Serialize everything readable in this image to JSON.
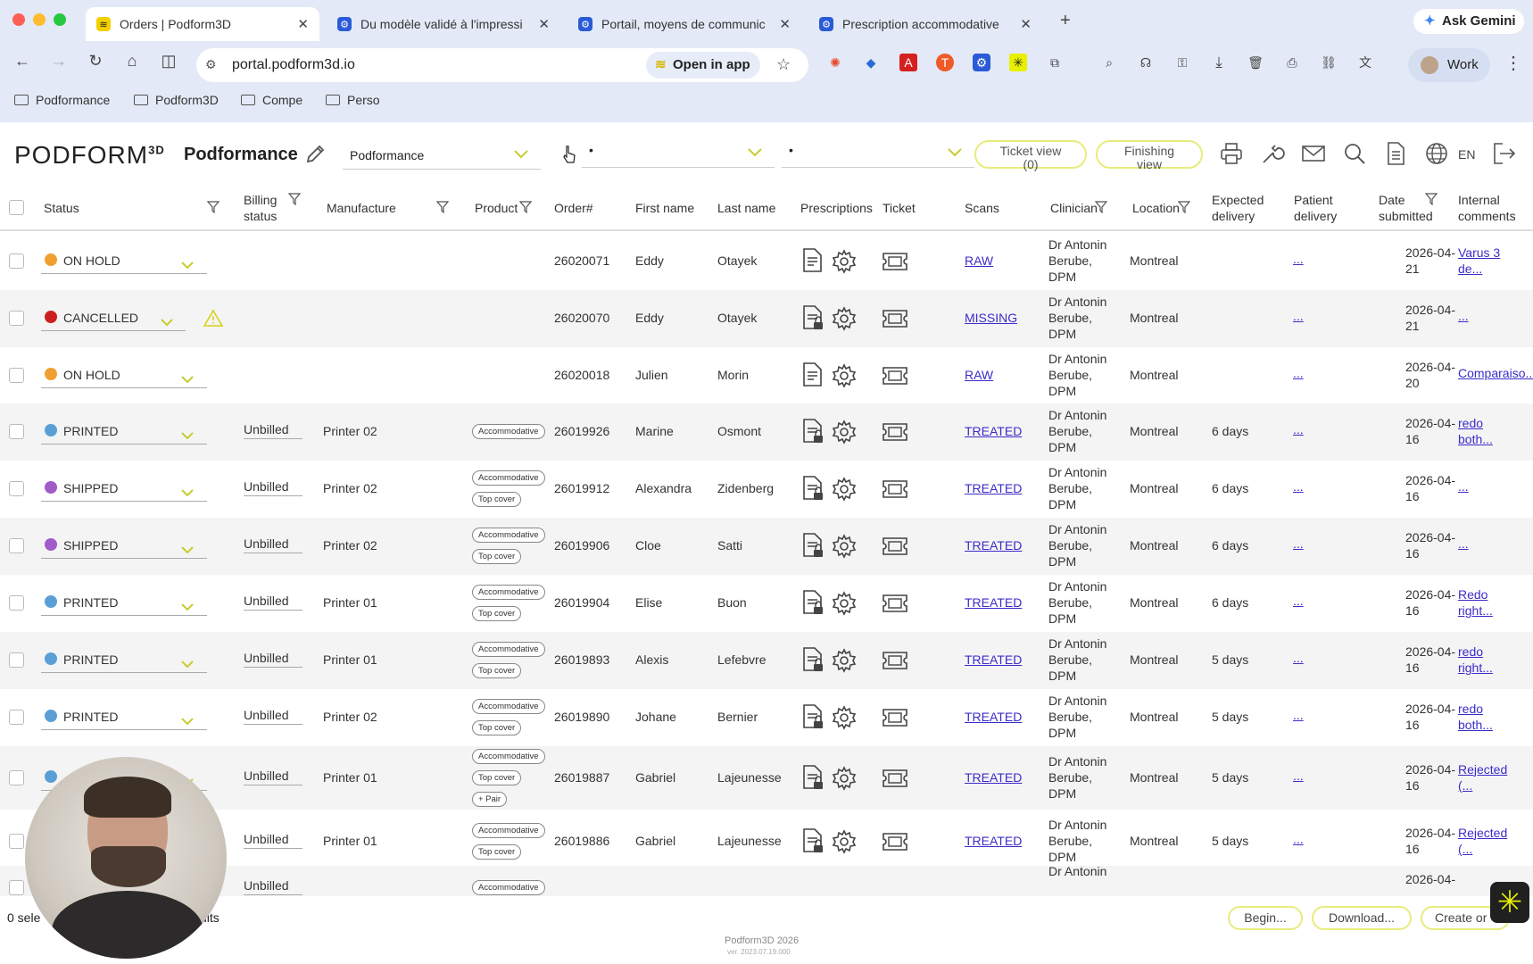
{
  "browser": {
    "tabs": [
      {
        "title": "Orders | Podform3D",
        "active": true
      },
      {
        "title": "Du modèle validé à l'impressi",
        "active": false
      },
      {
        "title": "Portail, moyens de communic",
        "active": false
      },
      {
        "title": "Prescription accommodative",
        "active": false
      }
    ],
    "new_tab": "+",
    "ask": "Ask Gemini",
    "url": "portal.podform3d.io",
    "open_in_app": "Open in app",
    "profile": "Work",
    "bookmarks": [
      "Podformance",
      "Podform3D",
      "Compe",
      "Perso"
    ]
  },
  "app": {
    "logo": "PODFORM",
    "logo_sup": "3D",
    "clinic": "Podformance",
    "select1": "Podformance",
    "select2": "•",
    "select3": "•",
    "ticket_view": "Ticket view",
    "ticket_count": "(0)",
    "finishing_view": "Finishing view",
    "lang": "EN"
  },
  "columns": {
    "status": "Status",
    "billing": "Billing status",
    "manufacture": "Manufacture",
    "product": "Product",
    "order": "Order#",
    "first": "First name",
    "last": "Last name",
    "prescriptions": "Prescriptions",
    "ticket": "Ticket",
    "scans": "Scans",
    "clinician": "Clinician",
    "location": "Location",
    "expected": "Expected delivery",
    "patient": "Patient delivery",
    "date": "Date submitted",
    "comments": "Internal comments"
  },
  "rows": [
    {
      "status": "ON HOLD",
      "color": "#f0a030",
      "billing": "",
      "manufacture": "",
      "tags": [],
      "order": "26020071",
      "first": "Eddy",
      "last": "Otayek",
      "scan": "RAW",
      "clin1": "Dr Antonin",
      "clin2": "Berube,",
      "clin3": "DPM",
      "location": "Montreal",
      "expected": "",
      "patient": "...",
      "date1": "2026-04-",
      "date2": "21",
      "c1": "Varus 3",
      "c2": "de..."
    },
    {
      "status": "CANCELLED",
      "color": "#cc2020",
      "billing": "",
      "manufacture": "",
      "tags": [],
      "order": "26020070",
      "first": "Eddy",
      "last": "Otayek",
      "scan": "MISSING",
      "clin1": "Dr Antonin",
      "clin2": "Berube,",
      "clin3": "DPM",
      "location": "Montreal",
      "expected": "",
      "patient": "...",
      "date1": "2026-04-",
      "date2": "21",
      "c1": "...",
      "c2": ""
    },
    {
      "status": "ON HOLD",
      "color": "#f0a030",
      "billing": "",
      "manufacture": "",
      "tags": [],
      "order": "26020018",
      "first": "Julien",
      "last": "Morin",
      "scan": "RAW",
      "clin1": "Dr Antonin",
      "clin2": "Berube,",
      "clin3": "DPM",
      "location": "Montreal",
      "expected": "",
      "patient": "...",
      "date1": "2026-04-",
      "date2": "20",
      "c1": "Comparaiso...",
      "c2": ""
    },
    {
      "status": "PRINTED",
      "color": "#5a9fd6",
      "billing": "Unbilled",
      "manufacture": "Printer 02",
      "tags": [
        "Accommodative"
      ],
      "order": "26019926",
      "first": "Marine",
      "last": "Osmont",
      "scan": "TREATED",
      "clin1": "Dr Antonin",
      "clin2": "Berube,",
      "clin3": "DPM",
      "location": "Montreal",
      "expected": "6 days",
      "patient": "...",
      "date1": "2026-04-",
      "date2": "16",
      "c1": "redo",
      "c2": "both..."
    },
    {
      "status": "SHIPPED",
      "color": "#a05cc8",
      "billing": "Unbilled",
      "manufacture": "Printer 02",
      "tags": [
        "Accommodative",
        "Top cover"
      ],
      "order": "26019912",
      "first": "Alexandra",
      "last": "Zidenberg",
      "scan": "TREATED",
      "clin1": "Dr Antonin",
      "clin2": "Berube,",
      "clin3": "DPM",
      "location": "Montreal",
      "expected": "6 days",
      "patient": "...",
      "date1": "2026-04-",
      "date2": "16",
      "c1": "...",
      "c2": ""
    },
    {
      "status": "SHIPPED",
      "color": "#a05cc8",
      "billing": "Unbilled",
      "manufacture": "Printer 02",
      "tags": [
        "Accommodative",
        "Top cover"
      ],
      "order": "26019906",
      "first": "Cloe",
      "last": "Satti",
      "scan": "TREATED",
      "clin1": "Dr Antonin",
      "clin2": "Berube,",
      "clin3": "DPM",
      "location": "Montreal",
      "expected": "6 days",
      "patient": "...",
      "date1": "2026-04-",
      "date2": "16",
      "c1": "...",
      "c2": ""
    },
    {
      "status": "PRINTED",
      "color": "#5a9fd6",
      "billing": "Unbilled",
      "manufacture": "Printer 01",
      "tags": [
        "Accommodative",
        "Top cover"
      ],
      "order": "26019904",
      "first": "Elise",
      "last": "Buon",
      "scan": "TREATED",
      "clin1": "Dr Antonin",
      "clin2": "Berube,",
      "clin3": "DPM",
      "location": "Montreal",
      "expected": "6 days",
      "patient": "...",
      "date1": "2026-04-",
      "date2": "16",
      "c1": "Redo",
      "c2": "right..."
    },
    {
      "status": "PRINTED",
      "color": "#5a9fd6",
      "billing": "Unbilled",
      "manufacture": "Printer 01",
      "tags": [
        "Accommodative",
        "Top cover"
      ],
      "order": "26019893",
      "first": "Alexis",
      "last": "Lefebvre",
      "scan": "TREATED",
      "clin1": "Dr Antonin",
      "clin2": "Berube,",
      "clin3": "DPM",
      "location": "Montreal",
      "expected": "5 days",
      "patient": "...",
      "date1": "2026-04-",
      "date2": "16",
      "c1": "redo",
      "c2": "right..."
    },
    {
      "status": "PRINTED",
      "color": "#5a9fd6",
      "billing": "Unbilled",
      "manufacture": "Printer 02",
      "tags": [
        "Accommodative",
        "Top cover"
      ],
      "order": "26019890",
      "first": "Johane",
      "last": "Bernier",
      "scan": "TREATED",
      "clin1": "Dr Antonin",
      "clin2": "Berube,",
      "clin3": "DPM",
      "location": "Montreal",
      "expected": "5 days",
      "patient": "...",
      "date1": "2026-04-",
      "date2": "16",
      "c1": "redo",
      "c2": "both..."
    },
    {
      "status": "",
      "color": "#5a9fd6",
      "billing": "Unbilled",
      "manufacture": "Printer 01",
      "tags": [
        "Accommodative",
        "Top cover",
        "+ Pair"
      ],
      "order": "26019887",
      "first": "Gabriel",
      "last": "Lajeunesse",
      "scan": "TREATED",
      "clin1": "Dr Antonin",
      "clin2": "Berube,",
      "clin3": "DPM",
      "location": "Montreal",
      "expected": "5 days",
      "patient": "...",
      "date1": "2026-04-",
      "date2": "16",
      "c1": "Rejected",
      "c2": "(..."
    },
    {
      "status": "",
      "color": "#5a9fd6",
      "billing": "Unbilled",
      "manufacture": "Printer 01",
      "tags": [
        "Accommodative",
        "Top cover"
      ],
      "order": "26019886",
      "first": "Gabriel",
      "last": "Lajeunesse",
      "scan": "TREATED",
      "clin1": "Dr Antonin",
      "clin2": "Berube,",
      "clin3": "DPM",
      "location": "Montreal",
      "expected": "5 days",
      "patient": "...",
      "date1": "2026-04-",
      "date2": "16",
      "c1": "Rejected",
      "c2": "(..."
    },
    {
      "status": "",
      "color": "#5a9fd6",
      "billing": "Unbilled",
      "manufacture": "",
      "tags": [
        "Accommodative"
      ],
      "order": "",
      "first": "",
      "last": "",
      "scan": "",
      "clin1": "Dr Antonin",
      "clin2": "",
      "clin3": "",
      "location": "",
      "expected": "",
      "patient": "",
      "date1": "2026-04-",
      "date2": "",
      "c1": "",
      "c2": ""
    }
  ],
  "footer": {
    "selected": "0 sele",
    "results": "ults",
    "begin": "Begin...",
    "download": "Download...",
    "create": "Create or",
    "copyright": "Podform3D 2026",
    "version": "ver. 2023.07.19.000"
  }
}
